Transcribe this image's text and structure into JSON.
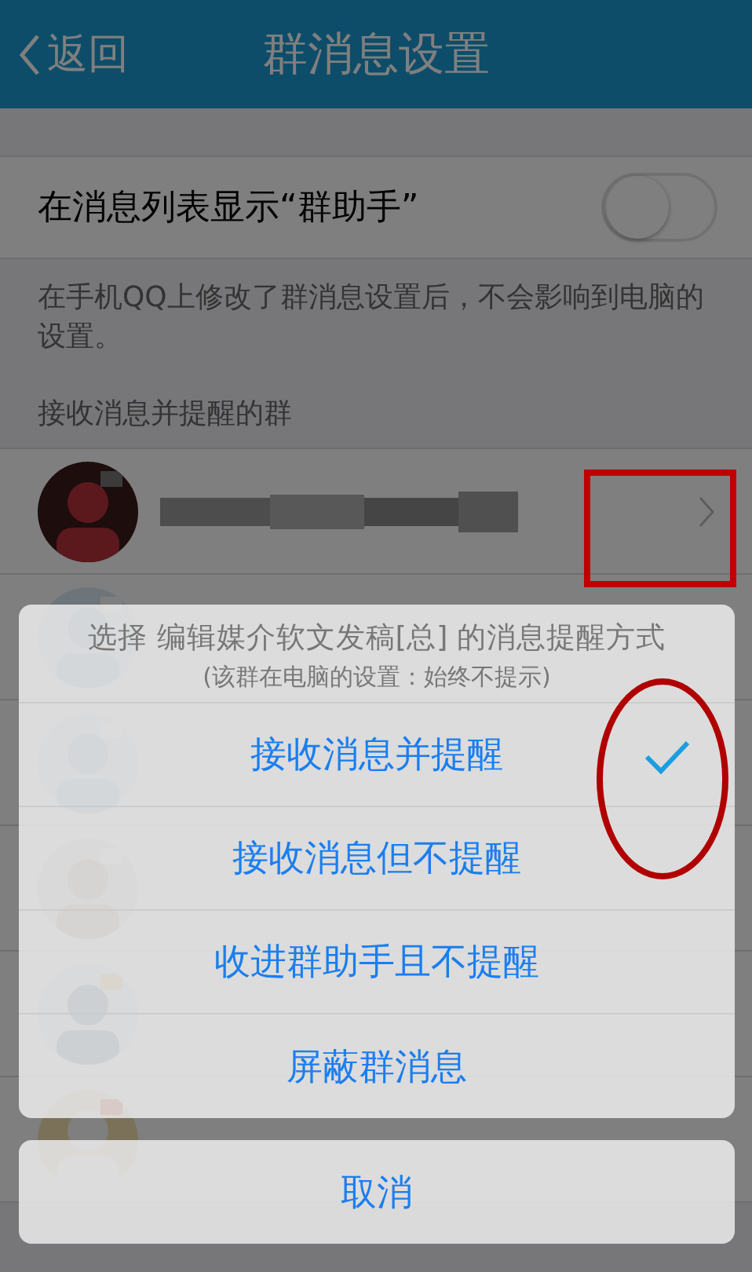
{
  "header": {
    "back": "返回",
    "title": "群消息设置"
  },
  "settings": {
    "toggle_label": "在消息列表显示“群助手”",
    "toggle_on": false,
    "note": "在手机QQ上修改了群消息设置后，不会影响到电脑的设置。",
    "section_title": "接收消息并提醒的群"
  },
  "sheet": {
    "title": "选择 编辑媒介软文发稿[总] 的消息提醒方式",
    "subtitle": "(该群在电脑的设置：始终不提示)",
    "options": [
      {
        "label": "接收消息并提醒",
        "selected": true
      },
      {
        "label": "接收消息但不提醒",
        "selected": false
      },
      {
        "label": "收进群助手且不提醒",
        "selected": false
      },
      {
        "label": "屏蔽群消息",
        "selected": false
      }
    ],
    "cancel": "取消"
  }
}
